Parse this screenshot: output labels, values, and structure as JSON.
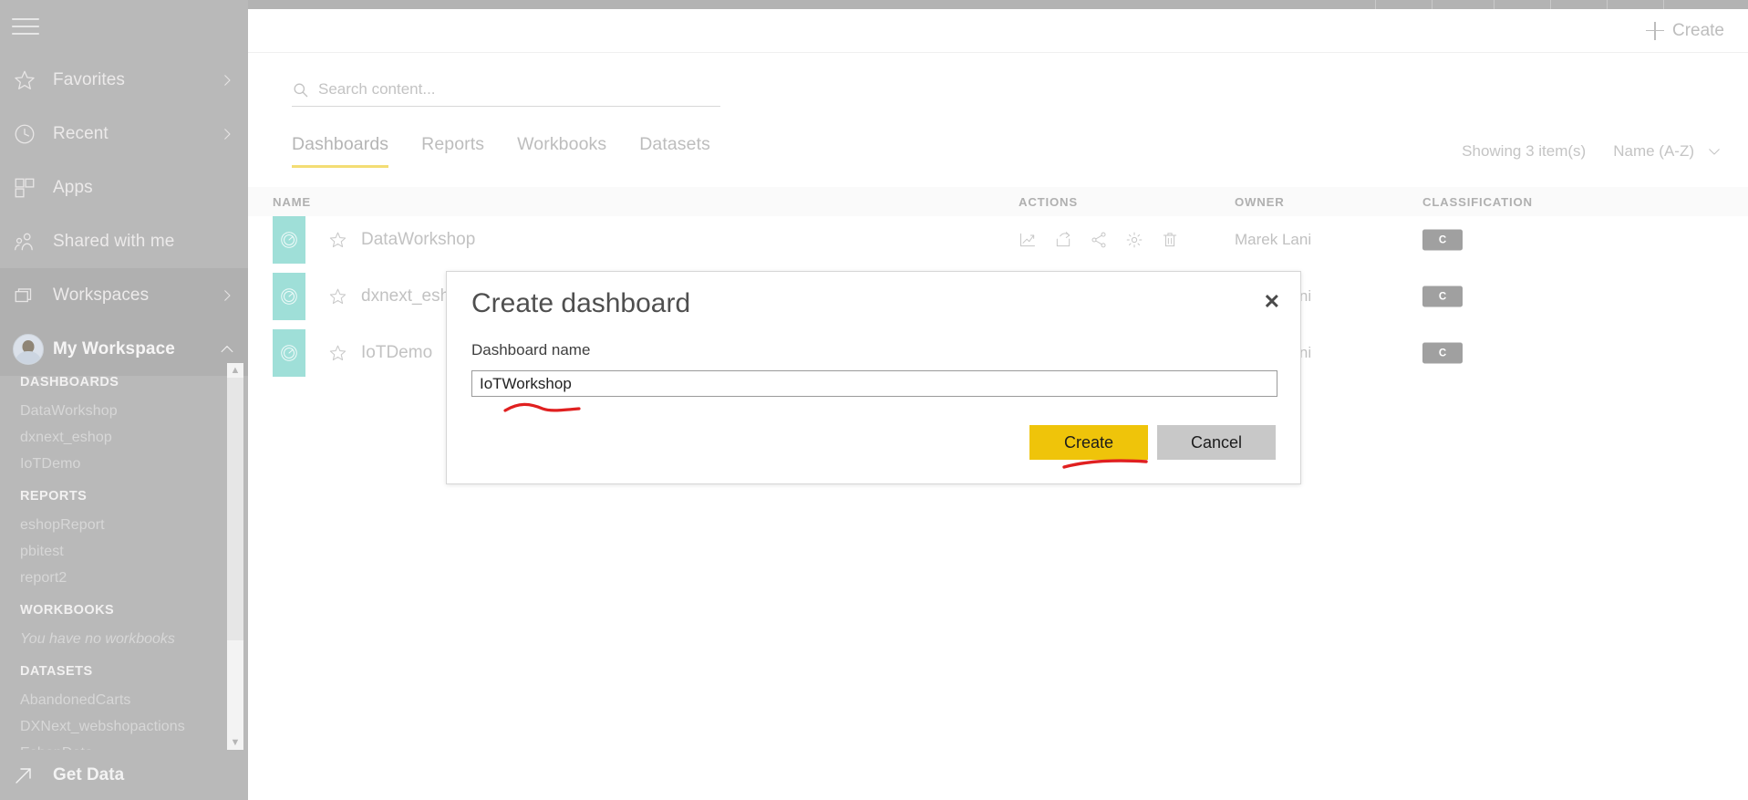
{
  "browser": {
    "tab_accent_color": "#f5ea9e"
  },
  "nav": {
    "menu_icon": "hamburger-icon",
    "items": [
      {
        "label": "Favorites",
        "icon": "star-icon",
        "chevron": "chevron-right-icon",
        "highlighted": false
      },
      {
        "label": "Recent",
        "icon": "clock-icon",
        "chevron": "chevron-right-icon",
        "highlighted": false
      },
      {
        "label": "Apps",
        "icon": "apps-icon",
        "chevron": "",
        "highlighted": false
      },
      {
        "label": "Shared with me",
        "icon": "shared-people-icon",
        "chevron": "",
        "highlighted": false
      },
      {
        "label": "Workspaces",
        "icon": "workspaces-icon",
        "chevron": "chevron-right-icon",
        "highlighted": true
      }
    ],
    "workspace": {
      "label": "My Workspace",
      "avatar": "user-avatar",
      "chevron": "chevron-up-icon"
    },
    "groups": [
      {
        "title": "DASHBOARDS",
        "items": [
          "DataWorkshop",
          "dxnext_eshop",
          "IoTDemo"
        ],
        "empty_text": ""
      },
      {
        "title": "REPORTS",
        "items": [
          "eshopReport",
          "pbitest",
          "report2"
        ],
        "empty_text": ""
      },
      {
        "title": "WORKBOOKS",
        "items": [],
        "empty_text": "You have no workbooks"
      },
      {
        "title": "DATASETS",
        "items": [
          "AbandonedCarts",
          "DXNext_webshopactions",
          "EshopData"
        ],
        "empty_text": ""
      }
    ],
    "footer": {
      "label": "Get Data",
      "icon": "arrow-up-right-icon"
    }
  },
  "topbar": {
    "create_label": "Create",
    "create_icon": "plus-icon"
  },
  "search": {
    "placeholder": "Search content...",
    "icon": "search-icon",
    "value": ""
  },
  "tabs": [
    {
      "label": "Dashboards",
      "active": true
    },
    {
      "label": "Reports",
      "active": false
    },
    {
      "label": "Workbooks",
      "active": false
    },
    {
      "label": "Datasets",
      "active": false
    }
  ],
  "list_meta": {
    "showing": "Showing 3 item(s)",
    "sort_label": "Name (A-Z)",
    "sort_icon": "chevron-down-icon"
  },
  "table": {
    "columns": [
      "NAME",
      "ACTIONS",
      "OWNER",
      "CLASSIFICATION"
    ],
    "action_icons": [
      "line-chart-icon",
      "export-icon",
      "share-nodes-icon",
      "gear-icon",
      "trash-icon"
    ],
    "rows": [
      {
        "tile_icon": "gauge-icon",
        "star": "star-outline-icon",
        "name": "DataWorkshop",
        "owner": "Marek Lani",
        "classification": "C"
      },
      {
        "tile_icon": "gauge-icon",
        "star": "star-outline-icon",
        "name": "dxnext_eshop",
        "owner": "Marek Lani",
        "classification": "C"
      },
      {
        "tile_icon": "gauge-icon",
        "star": "star-outline-icon",
        "name": "IoTDemo",
        "owner": "Marek Lani",
        "classification": "C"
      }
    ]
  },
  "modal": {
    "title": "Create dashboard",
    "close_icon": "close-icon",
    "field_label": "Dashboard name",
    "input_value": "IoTWorkshop",
    "input_placeholder": "",
    "primary_button": "Create",
    "secondary_button": "Cancel"
  },
  "colors": {
    "accent_yellow": "#efc40a",
    "tab_underline": "#f3dd74",
    "tile_teal": "#9fdfd8",
    "badge_gray": "#a0a0a0",
    "nav_bg": "#b9b9b9",
    "annotation_red": "#e02020"
  }
}
